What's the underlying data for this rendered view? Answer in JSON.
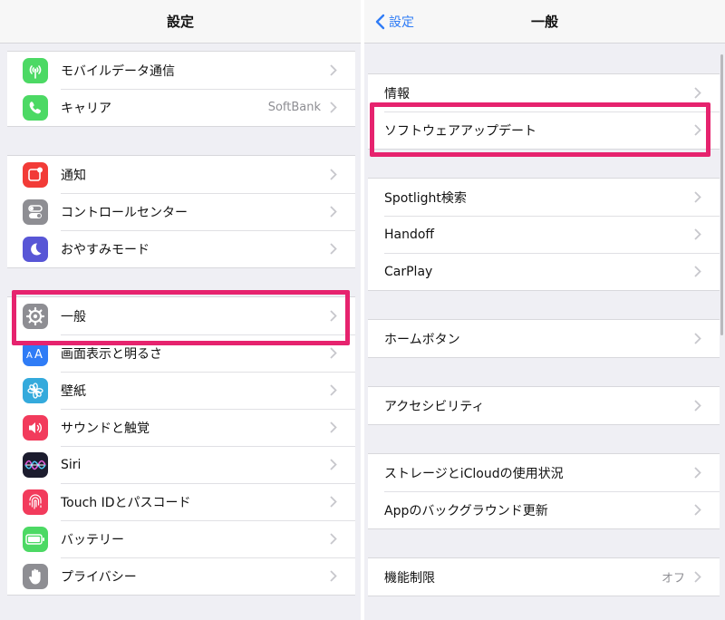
{
  "left": {
    "title": "設定",
    "groups": [
      {
        "rows": [
          {
            "label": "モバイルデータ通信",
            "icon": "antenna-icon",
            "color": "#4cd964"
          },
          {
            "label": "キャリア",
            "value": "SoftBank",
            "icon": "phone-icon",
            "color": "#4cd964"
          }
        ]
      },
      {
        "rows": [
          {
            "label": "通知",
            "icon": "notification-icon",
            "color": "#f23b37"
          },
          {
            "label": "コントロールセンター",
            "icon": "toggle-icon",
            "color": "#8e8e93"
          },
          {
            "label": "おやすみモード",
            "icon": "moon-icon",
            "color": "#5856d6"
          }
        ]
      },
      {
        "rows": [
          {
            "label": "一般",
            "icon": "gear-icon",
            "color": "#8e8e93"
          },
          {
            "label": "画面表示と明るさ",
            "icon": "text-size-icon",
            "color": "#2f7cf6"
          },
          {
            "label": "壁紙",
            "icon": "flower-icon",
            "color": "#34aadc"
          },
          {
            "label": "サウンドと触覚",
            "icon": "speaker-icon",
            "color": "#f23b5c"
          },
          {
            "label": "Siri",
            "icon": "siri-icon",
            "color": "#1c1c2e"
          },
          {
            "label": "Touch IDとパスコード",
            "icon": "fingerprint-icon",
            "color": "#f23b5c"
          },
          {
            "label": "バッテリー",
            "icon": "battery-icon",
            "color": "#4cd964"
          },
          {
            "label": "プライバシー",
            "icon": "hand-icon",
            "color": "#8e8e93"
          }
        ]
      }
    ]
  },
  "right": {
    "back_label": "設定",
    "title": "一般",
    "groups": [
      {
        "rows": [
          {
            "label": "情報"
          },
          {
            "label": "ソフトウェアアップデート"
          }
        ]
      },
      {
        "rows": [
          {
            "label": "Spotlight検索"
          },
          {
            "label": "Handoff"
          },
          {
            "label": "CarPlay"
          }
        ]
      },
      {
        "rows": [
          {
            "label": "ホームボタン"
          }
        ]
      },
      {
        "rows": [
          {
            "label": "アクセシビリティ"
          }
        ]
      },
      {
        "rows": [
          {
            "label": "ストレージとiCloudの使用状況"
          },
          {
            "label": "Appのバックグラウンド更新"
          }
        ]
      },
      {
        "rows": [
          {
            "label": "機能制限",
            "value": "オフ"
          }
        ]
      }
    ]
  },
  "highlight_color": "#e6236e"
}
